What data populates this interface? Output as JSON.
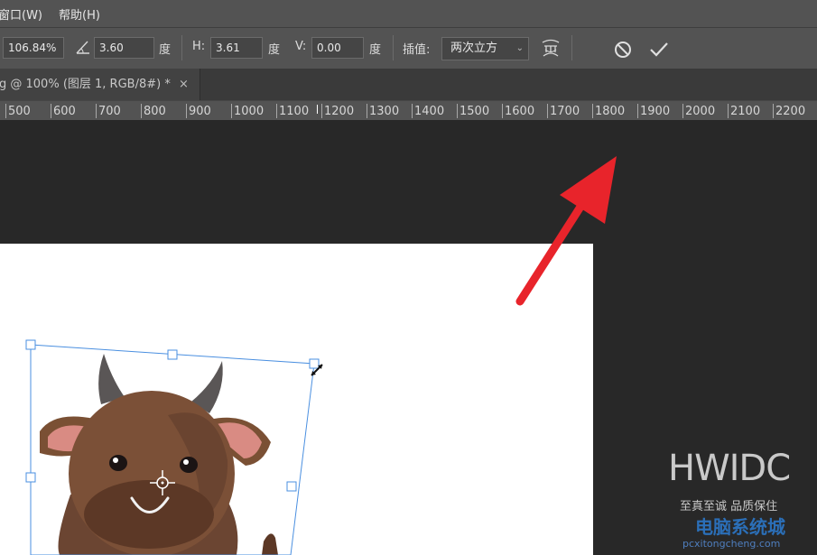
{
  "menubar": {
    "items": [
      "窗口(W)",
      "帮助(H)"
    ]
  },
  "options": {
    "scale_value": "106.84%",
    "angle_value": "3.60",
    "angle_unit": "度",
    "h_label": "H:",
    "h_value": "3.61",
    "h_unit": "度",
    "v_label": "V:",
    "v_value": "0.00",
    "v_unit": "度",
    "interp_label": "插值:",
    "interp_value": "两次立方",
    "icons": [
      "angle-icon",
      "warp-icon",
      "cancel-transform-icon",
      "commit-transform-icon"
    ]
  },
  "document_tab": {
    "title": "g @ 100% (图层 1, RGB/8#) *",
    "close": "×"
  },
  "ruler": {
    "labels": [
      "500",
      "600",
      "700",
      "800",
      "900",
      "1000",
      "1100",
      "1200",
      "1300",
      "1400",
      "1500",
      "1600",
      "1700",
      "1800",
      "1900",
      "2000",
      "2100",
      "2200"
    ]
  },
  "annotation": {
    "arrow_color": "#e8242b"
  },
  "watermark": {
    "main": "HWIDC",
    "sub": "至真至诚 品质保住",
    "brand": "电脑系统城",
    "url": "pcxitongcheng.com"
  },
  "colors": {
    "panel": "#535353",
    "canvas_bg": "#282828",
    "selection": "#4a8fe0",
    "arrow": "#e8242b"
  }
}
